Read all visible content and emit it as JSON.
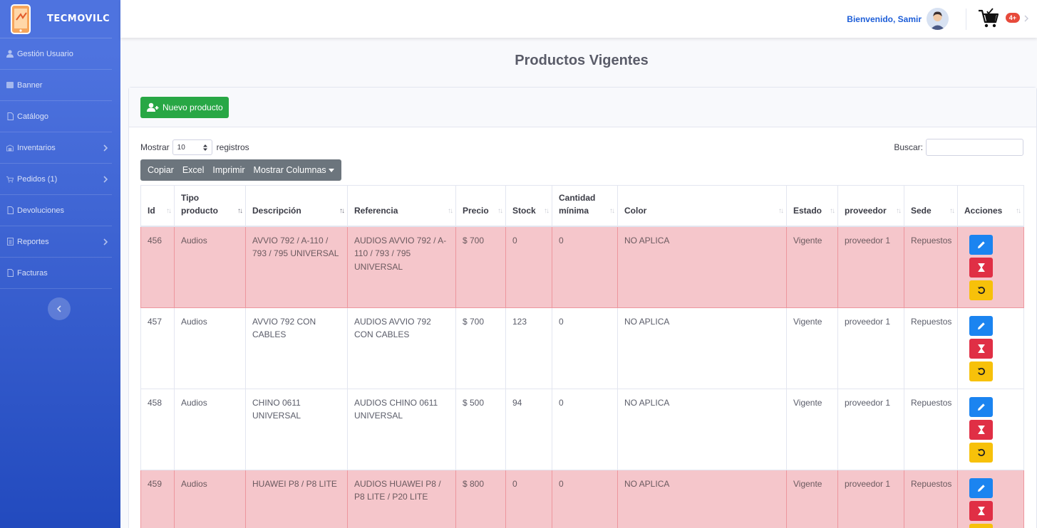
{
  "brand": {
    "name": "TECMOVILC"
  },
  "sidebar": {
    "items": [
      {
        "label": "Gestión Usuario",
        "icon": "user-icon",
        "has_submenu": false
      },
      {
        "label": "Banner",
        "icon": "banner-icon",
        "has_submenu": false
      },
      {
        "label": "Catálogo",
        "icon": "file-icon",
        "has_submenu": false
      },
      {
        "label": "Inventarios",
        "icon": "warehouse-icon",
        "has_submenu": true
      },
      {
        "label": "Pedidos (1)",
        "icon": "cart-icon",
        "has_submenu": true
      },
      {
        "label": "Devoluciones",
        "icon": "file-icon",
        "has_submenu": false
      },
      {
        "label": "Reportes",
        "icon": "report-icon",
        "has_submenu": true
      },
      {
        "label": "Facturas",
        "icon": "file-icon",
        "has_submenu": false
      }
    ]
  },
  "topbar": {
    "welcome": "Bienvenido, Samir",
    "cart_badge": "4+"
  },
  "page": {
    "title": "Productos Vigentes"
  },
  "toolbar": {
    "new_product": "Nuevo producto"
  },
  "table_controls": {
    "show_label": "Mostrar",
    "page_length": "10",
    "records_label": "registros",
    "search_label": "Buscar:",
    "buttons": [
      "Copiar",
      "Excel",
      "Imprimir",
      "Mostrar Columnas"
    ]
  },
  "table": {
    "columns": [
      {
        "line1": "",
        "line2": "Id"
      },
      {
        "line1": "Tipo",
        "line2": "producto"
      },
      {
        "line1": "",
        "line2": "Descripción"
      },
      {
        "line1": "",
        "line2": "Referencia"
      },
      {
        "line1": "",
        "line2": "Precio"
      },
      {
        "line1": "",
        "line2": "Stock"
      },
      {
        "line1": "Cantidad",
        "line2": "mínima"
      },
      {
        "line1": "",
        "line2": "Color"
      },
      {
        "line1": "",
        "line2": "Estado"
      },
      {
        "line1": "",
        "line2": "proveedor"
      },
      {
        "line1": "",
        "line2": "Sede"
      },
      {
        "line1": "",
        "line2": "Acciones"
      }
    ],
    "rows": [
      {
        "highlight": true,
        "cells": [
          "456",
          "Audios",
          "AVVIO 792 / A-110 / 793 / 795 UNIVERSAL",
          "AUDIOS AVVIO 792 / A-110 / 793 / 795 UNIVERSAL",
          "$ 700",
          "0",
          "0",
          "NO APLICA",
          "Vigente",
          "proveedor 1",
          "Repuestos"
        ]
      },
      {
        "highlight": false,
        "cells": [
          "457",
          "Audios",
          "AVVIO 792 CON CABLES",
          "AUDIOS AVVIO 792 CON CABLES",
          "$ 700",
          "123",
          "0",
          "NO APLICA",
          "Vigente",
          "proveedor 1",
          "Repuestos"
        ]
      },
      {
        "highlight": false,
        "cells": [
          "458",
          "Audios",
          "CHINO 0611 UNIVERSAL",
          "AUDIOS CHINO 0611 UNIVERSAL",
          "$ 500",
          "94",
          "0",
          "NO APLICA",
          "Vigente",
          "proveedor 1",
          "Repuestos"
        ]
      },
      {
        "highlight": true,
        "cells": [
          "459",
          "Audios",
          "HUAWEI P8 / P8 LITE",
          "AUDIOS HUAWEI P8 / P8 LITE / P20 LITE",
          "$ 800",
          "0",
          "0",
          "NO APLICA",
          "Vigente",
          "proveedor 1",
          "Repuestos"
        ]
      }
    ]
  },
  "colors": {
    "sidebar": "#4e73df",
    "new_button": "#28a745",
    "row_highlight": "#f5c6cb",
    "edit": "#1b84f0",
    "delete": "#e02f45",
    "restore": "#f7c10a"
  }
}
